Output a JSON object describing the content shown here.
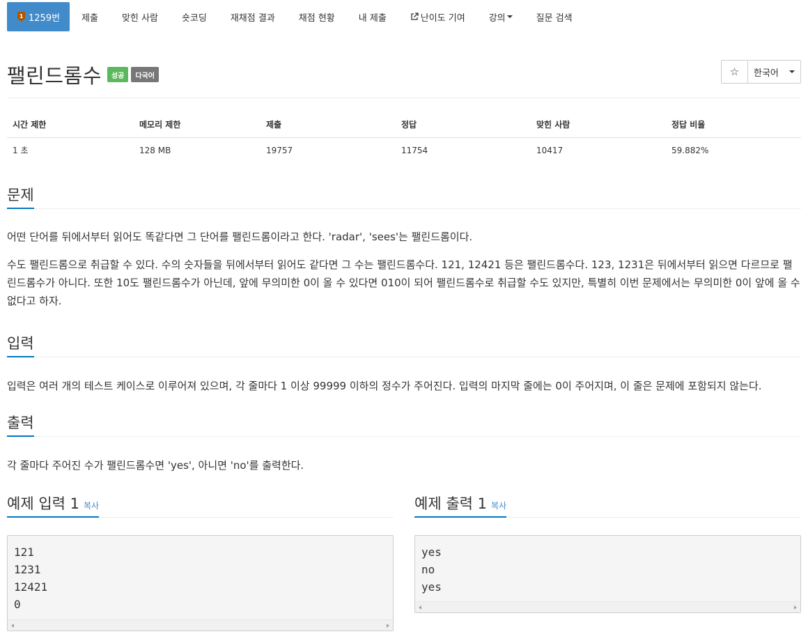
{
  "nav": {
    "problem_no": "1259번",
    "items": [
      "제출",
      "맞힌 사람",
      "숏코딩",
      "재채점 결과",
      "채점 현황",
      "내 제출",
      "난이도 기여",
      "강의",
      "질문 검색"
    ]
  },
  "problem": {
    "title": "팰린드롬수",
    "badge_success": "성공",
    "badge_multilang": "다국어",
    "star": "☆",
    "language": "한국어"
  },
  "info_table": {
    "headers": [
      "시간 제한",
      "메모리 제한",
      "제출",
      "정답",
      "맞힌 사람",
      "정답 비율"
    ],
    "values": [
      "1 초",
      "128 MB",
      "19757",
      "11754",
      "10417",
      "59.882%"
    ]
  },
  "sections": {
    "problem_title": "문제",
    "problem_p1": "어떤 단어를 뒤에서부터 읽어도 똑같다면 그 단어를 팰린드롬이라고 한다. 'radar', 'sees'는 팰린드롬이다.",
    "problem_p2": "수도 팰린드롬으로 취급할 수 있다. 수의 숫자들을 뒤에서부터 읽어도 같다면 그 수는 팰린드롬수다. 121, 12421 등은 팰린드롬수다. 123, 1231은 뒤에서부터 읽으면 다르므로 팰린드롬수가 아니다. 또한 10도 팰린드롬수가 아닌데, 앞에 무의미한 0이 올 수 있다면 010이 되어 팰린드롬수로 취급할 수도 있지만, 특별히 이번 문제에서는 무의미한 0이 앞에 올 수 없다고 하자.",
    "input_title": "입력",
    "input_p": "입력은 여러 개의 테스트 케이스로 이루어져 있으며, 각 줄마다 1 이상 99999 이하의 정수가 주어진다. 입력의 마지막 줄에는 0이 주어지며, 이 줄은 문제에 포함되지 않는다.",
    "output_title": "출력",
    "output_p": "각 줄마다 주어진 수가 팰린드롬수면 'yes', 아니면 'no'를 출력한다."
  },
  "samples": {
    "input_title": "예제 입력 1",
    "output_title": "예제 출력 1",
    "copy_label": "복사",
    "input_text": "121\n1231\n12421\n0",
    "output_text": "yes\nno\nyes"
  },
  "colors": {
    "active_nav": "#428bca",
    "success": "#5cb85c",
    "section_underline": "#0076c0"
  }
}
